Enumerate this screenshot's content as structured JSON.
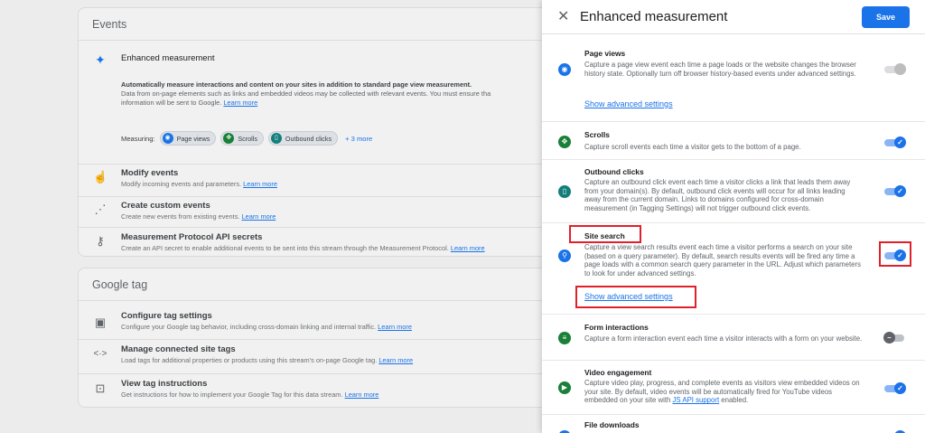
{
  "events_card": {
    "title": "Events",
    "enhanced": {
      "title": "Enhanced measurement",
      "line1": "Automatically measure interactions and content on your sites in addition to standard page view measurement.",
      "line2": "Data from on-page elements such as links and embedded videos may be collected with relevant events. You must ensure tha",
      "line3": "information will be sent to Google.",
      "learn_more": "Learn more",
      "measuring_label": "Measuring:",
      "chips": [
        "Page views",
        "Scrolls",
        "Outbound clicks"
      ],
      "more": "+ 3 more"
    },
    "rows": [
      {
        "title": "Modify events",
        "desc": "Modify incoming events and parameters.",
        "link": "Learn more"
      },
      {
        "title": "Create custom events",
        "desc": "Create new events from existing events.",
        "link": "Learn more"
      },
      {
        "title": "Measurement Protocol API secrets",
        "desc": "Create an API secret to enable additional events to be sent into this stream through the Measurement Protocol.",
        "link": "Learn more"
      }
    ]
  },
  "tag_card": {
    "title": "Google tag",
    "rows": [
      {
        "title": "Configure tag settings",
        "desc": "Configure your Google tag behavior, including cross-domain linking and internal traffic.",
        "link": "Learn more"
      },
      {
        "title": "Manage connected site tags",
        "desc": "Load tags for additional properties or products using this stream's on-page Google tag.",
        "link": "Learn more"
      },
      {
        "title": "View tag instructions",
        "desc": "Get instructions for how to implement your Google Tag for this data stream.",
        "link": "Learn more"
      }
    ]
  },
  "panel": {
    "title": "Enhanced measurement",
    "save_label": "Save",
    "advanced_label": "Show advanced settings",
    "items": [
      {
        "title": "Page views",
        "desc": "Capture a page view event each time a page loads or the website changes the browser history state. Optionally turn off browser history-based events under advanced settings.",
        "toggle": "disabled-on"
      },
      {
        "title": "Scrolls",
        "desc": "Capture scroll events each time a visitor gets to the bottom of a page.",
        "toggle": "on"
      },
      {
        "title": "Outbound clicks",
        "desc": "Capture an outbound click event each time a visitor clicks a link that leads them away from your domain(s). By default, outbound click events will occur for all links leading away from the current domain. Links to domains configured for cross-domain measurement (in Tagging Settings) will not trigger outbound click events.",
        "toggle": "on"
      },
      {
        "title": "Site search",
        "desc": "Capture a view search results event each time a visitor performs a search on your site (based on a query parameter). By default, search results events will be fired any time a page loads with a common search query parameter in the URL. Adjust which parameters to look for under advanced settings.",
        "toggle": "on"
      },
      {
        "title": "Form interactions",
        "desc": "Capture a form interaction event each time a visitor interacts with a form on your website.",
        "toggle": "off"
      },
      {
        "title": "Video engagement",
        "desc_before_link": "Capture video play, progress, and complete events as visitors view embedded videos on your site. By default, video events will be automatically fired for YouTube videos embedded on your site with ",
        "link": "JS API support",
        "desc_after_link": " enabled.",
        "toggle": "on"
      },
      {
        "title": "File downloads",
        "toggle": "on"
      }
    ]
  },
  "colors": {
    "accent": "#1a73e8",
    "highlight": "#e0202a"
  }
}
